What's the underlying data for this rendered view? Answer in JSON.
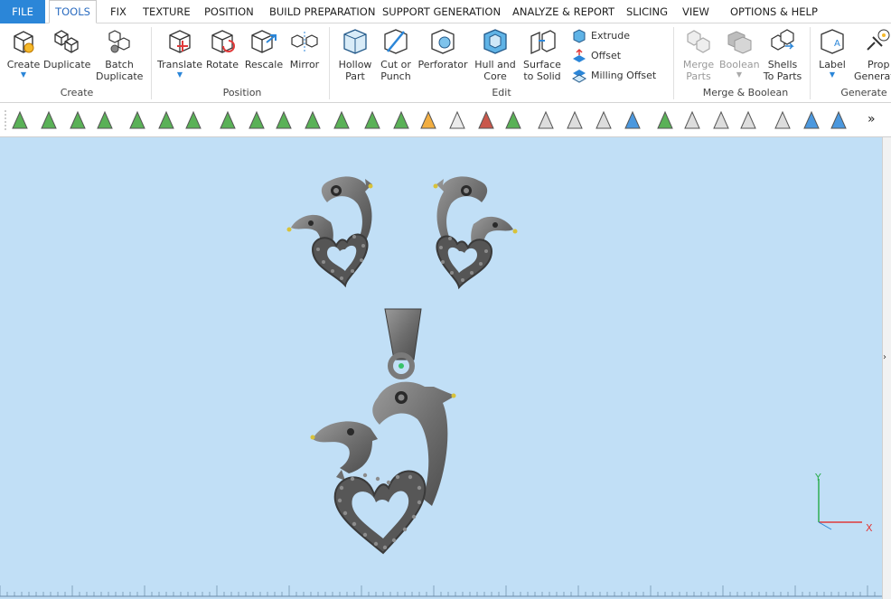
{
  "menu": {
    "file": "FILE",
    "tabs": [
      "TOOLS",
      "FIX",
      "TEXTURE",
      "POSITION",
      "BUILD PREPARATION",
      "SUPPORT GENERATION",
      "ANALYZE & REPORT",
      "SLICING",
      "VIEW",
      "OPTIONS & HELP"
    ],
    "active": "TOOLS"
  },
  "ribbon": {
    "create": {
      "label": "Create",
      "btn_create": "Create",
      "btn_duplicate": "Duplicate",
      "btn_batch1": "Batch",
      "btn_batch2": "Duplicate"
    },
    "position": {
      "label": "Position",
      "btn_translate": "Translate",
      "btn_rotate": "Rotate",
      "btn_rescale": "Rescale",
      "btn_mirror": "Mirror"
    },
    "edit": {
      "label": "Edit",
      "btn_hollow1": "Hollow",
      "btn_hollow2": "Part",
      "btn_cut1": "Cut or",
      "btn_cut2": "Punch",
      "btn_perforator": "Perforator",
      "btn_hull1": "Hull and",
      "btn_hull2": "Core",
      "btn_surface1": "Surface",
      "btn_surface2": "to Solid",
      "btn_extrude": "Extrude",
      "btn_offset": "Offset",
      "btn_milling": "Milling Offset"
    },
    "merge": {
      "label": "Merge & Boolean",
      "btn_merge1": "Merge",
      "btn_merge2": "Parts",
      "btn_boolean": "Boolean",
      "btn_shells1": "Shells",
      "btn_shells2": "To Parts"
    },
    "generate": {
      "label": "Generate",
      "btn_label": "Label",
      "btn_prop1": "Prop",
      "btn_prop2": "Generat"
    }
  },
  "toolbar": {
    "more": "»"
  },
  "colors": {
    "accent": "#2b86d8",
    "viewport": "#c1dff6",
    "model": "#6e6e6e",
    "axis_x": "#e03a3a",
    "axis_y": "#2fae52"
  },
  "axis": {
    "x": "X",
    "y": "Y"
  }
}
